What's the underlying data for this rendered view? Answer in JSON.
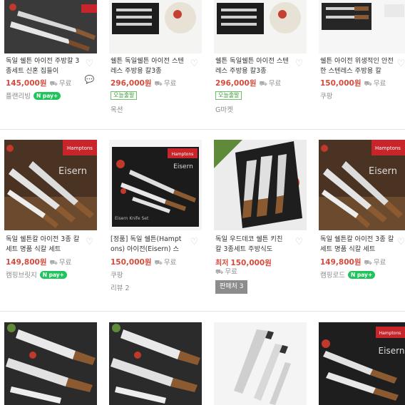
{
  "products": [
    {
      "title": "독일 쉘튼 아이전 주방칼 3종세트 신혼 집들이",
      "price": "145,000원",
      "shipping": "무료",
      "seller": "플랜리빙",
      "npay": "pay+"
    },
    {
      "title": "쉘튼 독일쉘튼 아이전 스텐레스 주방용 칼3종",
      "price": "296,000원",
      "shipping": "무료",
      "badge": "오늘출발",
      "seller": "옥션"
    },
    {
      "title": "쉘튼 독일쉘튼 아이전 스텐레스 주방용 칼3종",
      "price": "296,000원",
      "shipping": "무료",
      "badge": "오늘출발",
      "seller": "G마켓"
    },
    {
      "title": "쉘튼 아이전 위생적인 안전한 스텐레스 주방용 칼",
      "price": "150,000원",
      "shipping": "무료",
      "seller": "쿠팡"
    },
    {
      "title": "독일 쉘튼칼 아이전 3종 칼세트 명품 식칼 세트",
      "price": "149,800원",
      "shipping": "무료",
      "seller": "캠핑브릿지",
      "npay": "pay+"
    },
    {
      "title": "[정품] 독일 쉘튼(Hamptons) 아이전(Eisern) 스",
      "price": "150,000원",
      "shipping": "무료",
      "seller": "쿠팡",
      "review": "리뷰 2"
    },
    {
      "title": "독일 우드데코 쉘튼 키친 칼 3종세트 주방식도",
      "price_label": "최저",
      "price": "150,000원",
      "shipping": "무료",
      "sellers_button": "판매처 3"
    },
    {
      "title": "독일 쉘튼칼 아이전 3종 칼세트 명품 식칼 세트",
      "price": "149,800원",
      "shipping": "무료",
      "seller": "캠핑로드",
      "npay": "pay+"
    }
  ],
  "image_text": {
    "brand": "Hamptons",
    "eisern": "Eisern",
    "set_label": "Eisern Knife Set"
  }
}
